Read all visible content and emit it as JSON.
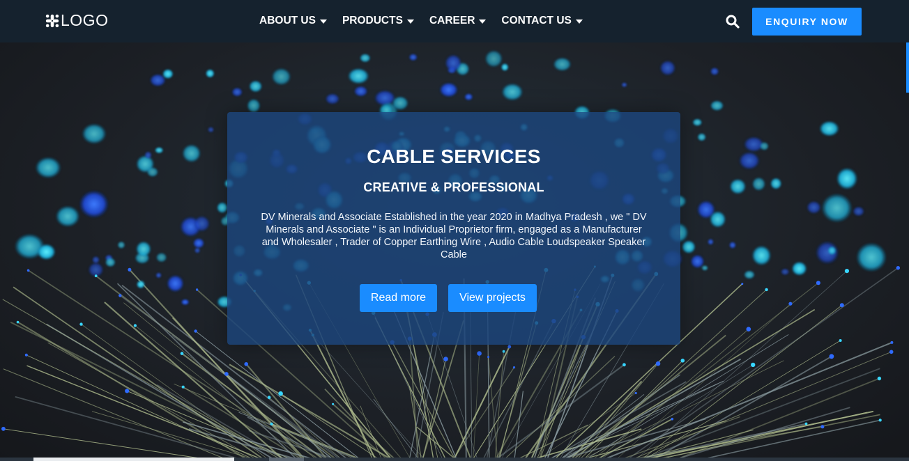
{
  "header": {
    "logo_text": "LOGO",
    "logo_icon": "slack-style-icon",
    "nav": [
      {
        "label": "ABOUT US",
        "icon": "caret-down-icon"
      },
      {
        "label": "PRODUCTS",
        "icon": "caret-down-icon"
      },
      {
        "label": "CAREER",
        "icon": "caret-down-icon"
      },
      {
        "label": "CONTACT US",
        "icon": "caret-down-icon"
      }
    ],
    "search_icon": "search-icon",
    "cta_label": "ENQUIRY NOW"
  },
  "hero": {
    "title": "CABLE SERVICES",
    "subtitle": "CREATIVE & PROFESSIONAL",
    "description": "DV Minerals and Associate Established in the year 2020 in Madhya Pradesh , we \" DV Minerals and Associate \" is an Individual Proprietor firm, engaged as a Manufacturer and Wholesaler , Trader of Copper Earthing Wire , Audio Cable Loudspeaker Speaker Cable",
    "primary_button": "Read more",
    "secondary_button": "View projects",
    "background": "fiber-optic-lights"
  },
  "colors": {
    "header_bg": "#15222e",
    "accent": "#1a8cff",
    "card_bg": "#1c467d",
    "text": "#ffffff"
  }
}
